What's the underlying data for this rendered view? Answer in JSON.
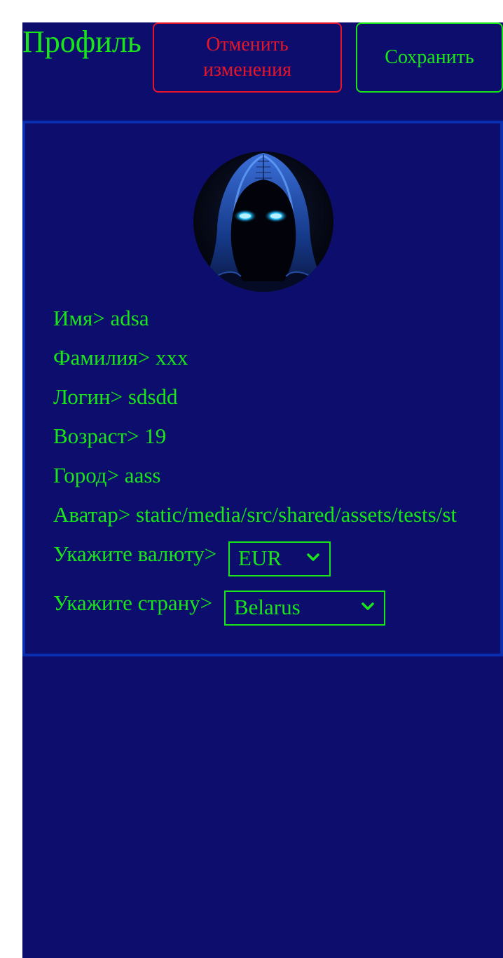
{
  "header": {
    "title": "Профиль",
    "cancel_label": "Отменить изменения",
    "save_label": "Сохранить"
  },
  "profile": {
    "avatar_icon": "hooded-figure-avatar",
    "fields": {
      "first_name": "Имя> adsa",
      "last_name": "Фамилия> xxx",
      "login": "Логин> sdsdd",
      "age": "Возраст> 19",
      "city": "Город> aass",
      "avatar_path": "Аватар> static/media/src/shared/assets/tests/st"
    },
    "currency": {
      "label": "Укажите валюту>",
      "selected": "EUR"
    },
    "country": {
      "label": "Укажите страну>",
      "selected": "Belarus"
    }
  },
  "colors": {
    "background": "#0d0d6e",
    "text": "#19e619",
    "cancel": "#e6162a",
    "card_border": "#0a2eb0"
  }
}
